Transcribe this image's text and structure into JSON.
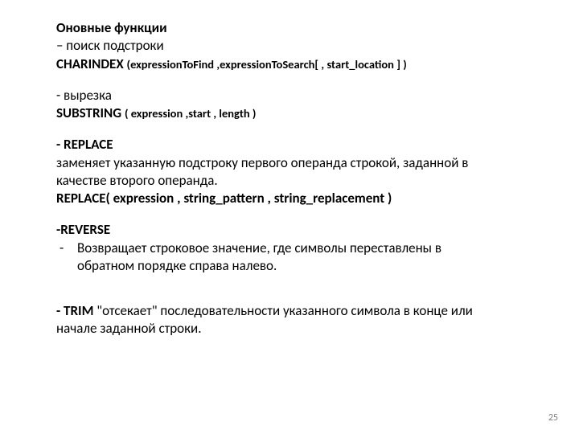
{
  "title": "Оновные функции",
  "charindex": {
    "intro": "– поиск подстроки",
    "func": "CHARINDEX ",
    "sig": "(expressionToFind ,expressionToSearch[ , start_location ] )"
  },
  "substring": {
    "intro": "- вырезка",
    "func": "SUBSTRING ",
    "sig": "( expression ,start , length )"
  },
  "replace": {
    "header": "- REPLACE",
    "desc1": "заменяет указанную подстроку первого операнда строкой, заданной в",
    "desc2": "качестве второго операнда.",
    "sigfull": "REPLACE( expression , string_pattern , string_replacement )"
  },
  "reverse": {
    "header": "-REVERSE",
    "dash": "-",
    "line1": "Возвращает строковое значение, где символы переставлены в",
    "line2": "обратном порядке справа налево."
  },
  "trim": {
    "bold": "- TRIM ",
    "rest1": "\"отсекает\" последовательности указанного символа в конце или",
    "rest2": "начале заданной строки."
  },
  "page": "25"
}
